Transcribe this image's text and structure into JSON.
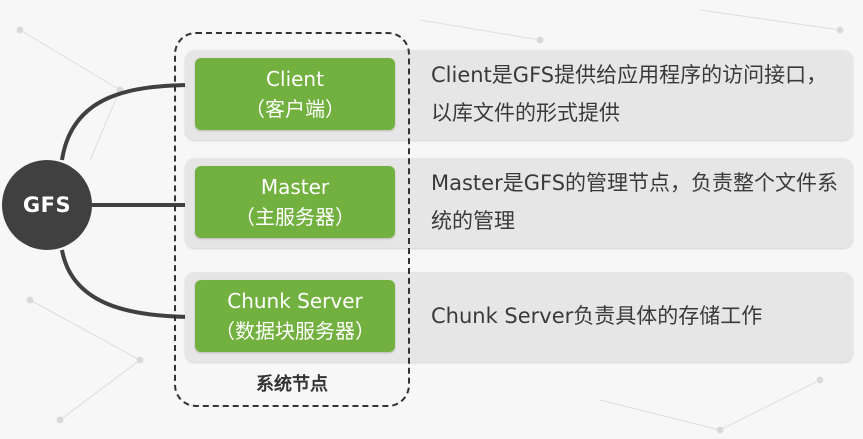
{
  "hub": {
    "label": "GFS"
  },
  "group": {
    "label": "系统节点"
  },
  "rows": [
    {
      "name": "Client",
      "cn": "（客户端）",
      "desc": "Client是GFS提供给应用程序的访问接口，以库文件的形式提供"
    },
    {
      "name": "Master",
      "cn": "（主服务器）",
      "desc": "Master是GFS的管理节点，负责整个文件系统的管理"
    },
    {
      "name": "Chunk Server",
      "cn": "（数据块服务器）",
      "desc": "Chunk Server负责具体的存储工作"
    }
  ],
  "colors": {
    "hub": "#404040",
    "node": "#72b13f",
    "row_bg": "#e6e6e6",
    "text": "#3a3a3a"
  }
}
